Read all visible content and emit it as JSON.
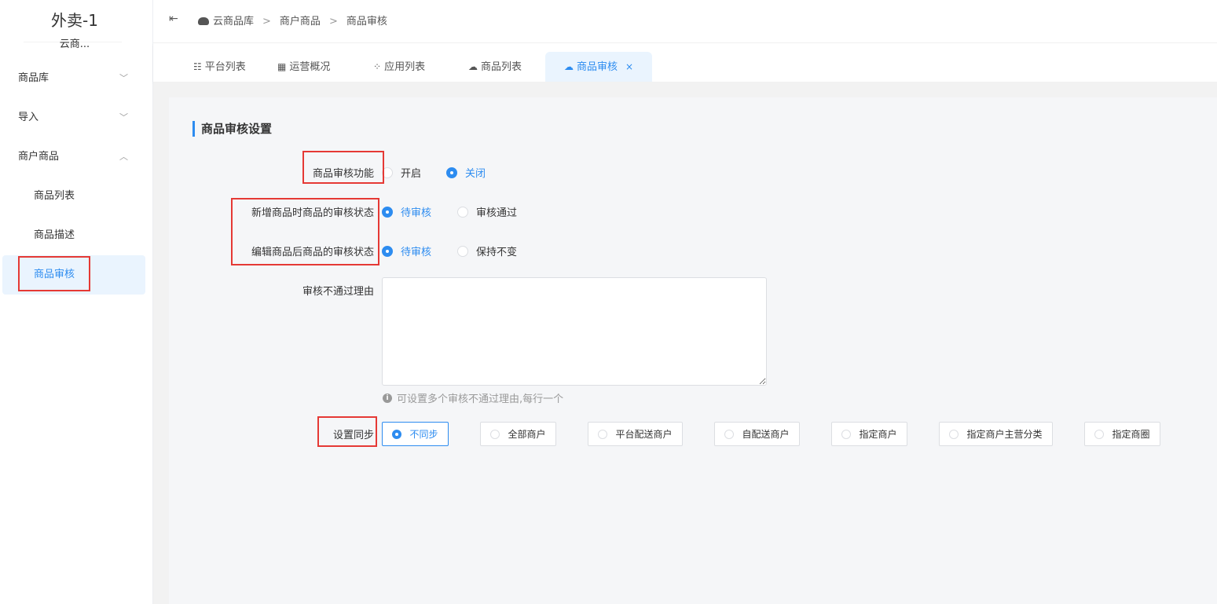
{
  "sidebar": {
    "app_title": "外卖-1",
    "app_subtitle": "云商...",
    "items": [
      {
        "label": "商品库",
        "chevron": "chevron-down-icon"
      },
      {
        "label": "导入",
        "chevron": "chevron-down-icon"
      },
      {
        "label": "商户商品",
        "chevron": "chevron-up-icon"
      },
      {
        "label": "商品列表"
      },
      {
        "label": "商品描述"
      },
      {
        "label": "商品审核",
        "active": true
      }
    ]
  },
  "header": {
    "collapse_icon": "menu-collapse-icon",
    "breadcrumb": [
      "云商品库",
      "商户商品",
      "商品审核"
    ],
    "separator": ">"
  },
  "tabs": [
    {
      "label": "平台列表",
      "icon": "list-icon"
    },
    {
      "label": "运营概况",
      "icon": "grid-icon"
    },
    {
      "label": "应用列表",
      "icon": "apps-icon"
    },
    {
      "label": "商品列表",
      "icon": "cloud-icon"
    },
    {
      "label": "商品审核",
      "icon": "cloud-icon",
      "active": true,
      "close": "×"
    }
  ],
  "form": {
    "section_title": "商品审核设置",
    "audit_function": {
      "label": "商品审核功能",
      "options": [
        "开启",
        "关闭"
      ],
      "selected": "关闭"
    },
    "new_status": {
      "label": "新增商品时商品的审核状态",
      "options": [
        "待审核",
        "审核通过"
      ],
      "selected": "待审核"
    },
    "edit_status": {
      "label": "编辑商品后商品的审核状态",
      "options": [
        "待审核",
        "保持不变"
      ],
      "selected": "待审核"
    },
    "reject_reason": {
      "label": "审核不通过理由",
      "value": "",
      "hint": "可设置多个审核不通过理由,每行一个"
    },
    "sync": {
      "label": "设置同步",
      "options": [
        "不同步",
        "全部商户",
        "平台配送商户",
        "自配送商户",
        "指定商户",
        "指定商户主营分类",
        "指定商圈"
      ],
      "selected": "不同步"
    }
  },
  "colors": {
    "accent": "#2d8cf0",
    "highlight_box": "#e53935"
  }
}
